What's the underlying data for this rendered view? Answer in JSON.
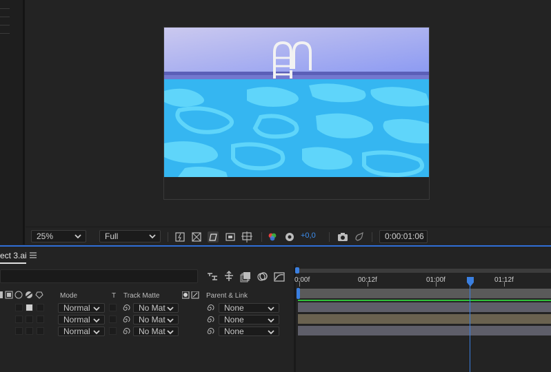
{
  "viewer": {
    "zoom": "25%",
    "resolution": "Full",
    "exposure": "+0,0",
    "timecode": "0:00:01:06"
  },
  "timeline": {
    "tab": "ect 3.ai",
    "columns": {
      "mode": "Mode",
      "t": "T",
      "track_matte": "Track Matte",
      "parent": "Parent & Link"
    },
    "layers": [
      {
        "mode": "Normal",
        "matte": "No Mat",
        "parent": "None"
      },
      {
        "mode": "Normal",
        "matte": "No Mat",
        "parent": "None"
      },
      {
        "mode": "Normal",
        "matte": "No Mat",
        "parent": "None"
      }
    ],
    "ruler": [
      "0:00f",
      "00:12f",
      "01:00f",
      "01:12f"
    ]
  },
  "colors": {
    "accent_blue": "#2f6fd8",
    "sky_top": "#c9c8ef",
    "sky_bottom": "#8e9df2",
    "water": "#35b7f2",
    "ripple": "#63d7fb",
    "green_bar": "#30c23a"
  }
}
